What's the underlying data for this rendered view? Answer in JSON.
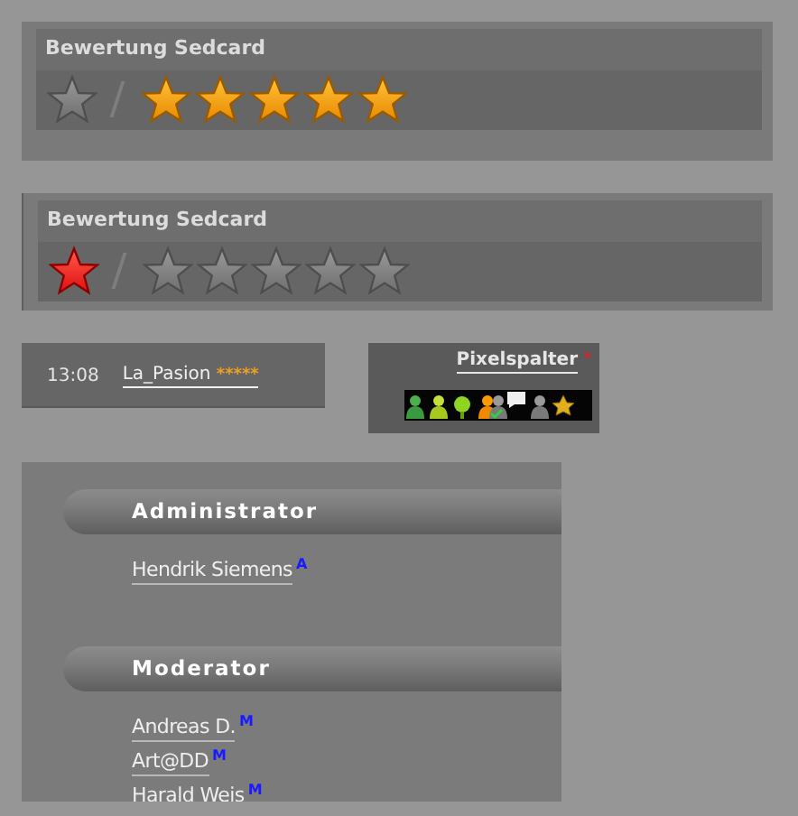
{
  "ratings": [
    {
      "title": "Bewertung Sedcard",
      "zero_selected": false,
      "stars": 5
    },
    {
      "title": "Bewertung Sedcard",
      "zero_selected": true,
      "stars": 0
    }
  ],
  "chat": {
    "time": "13:08",
    "user": "La_Pasion",
    "rank": "*****"
  },
  "profile": {
    "name": "Pixelspalter",
    "marker": "*"
  },
  "groups": [
    {
      "title": "Administrator",
      "members": [
        {
          "name": "Hendrik Siemens",
          "badge": "A"
        }
      ]
    },
    {
      "title": "Moderator",
      "members": [
        {
          "name": "Andreas D.",
          "badge": "M"
        },
        {
          "name": "Art@DD",
          "badge": "M"
        },
        {
          "name": "Harald Weis",
          "badge": "M"
        }
      ]
    }
  ]
}
